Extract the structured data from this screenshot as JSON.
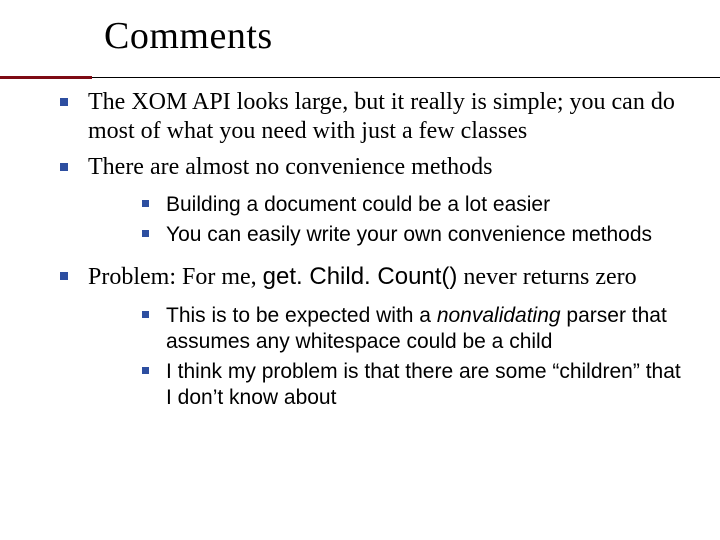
{
  "title": "Comments",
  "bullets": {
    "b1": "The XOM API looks large, but it really is simple; you can do most of what you need with just a few classes",
    "b2": "There are almost no convenience methods",
    "b2_sub": {
      "s1": "Building a document could be a lot easier",
      "s2": "You can easily write your own convenience methods"
    },
    "b3_pre": "Problem: For me, ",
    "b3_code": "get. Child. Count()",
    "b3_post": " never returns zero",
    "b3_sub": {
      "s1_pre": "This is to be expected with a ",
      "s1_em": "nonvalidating",
      "s1_post": " parser that assumes any whitespace could be a child",
      "s2": "I think my problem is that there are some “children” that I don’t know about"
    }
  }
}
